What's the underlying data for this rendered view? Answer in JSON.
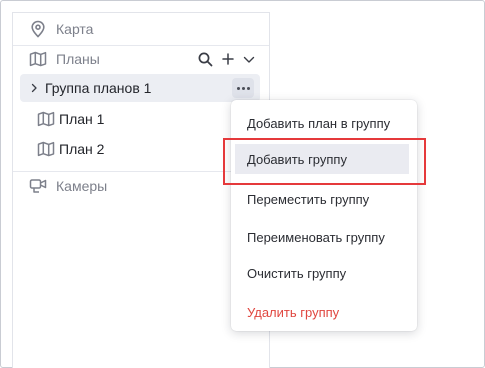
{
  "sidebar": {
    "map_item": {
      "label": "Карта",
      "icon": "location-pin-icon"
    },
    "plans_header": {
      "label": "Планы",
      "icon": "map-icon",
      "actions": [
        "search-icon",
        "plus-icon",
        "chevron-down-icon"
      ]
    },
    "group": {
      "label": "Группа планов 1",
      "more_label": "•••"
    },
    "plans": [
      {
        "label": "План 1",
        "icon": "map-icon"
      },
      {
        "label": "План 2",
        "icon": "map-icon"
      }
    ],
    "cameras_item": {
      "label": "Камеры",
      "icon": "camera-icon"
    }
  },
  "context_menu": {
    "items": [
      {
        "label": "Добавить план в группу"
      },
      {
        "label": "Добавить группу",
        "state": "highlighted"
      },
      {
        "label": "Переместить группу"
      },
      {
        "label": "Переименовать группу"
      },
      {
        "label": "Очистить группу"
      },
      {
        "label": "Удалить группу",
        "style": "danger"
      }
    ]
  },
  "colors": {
    "text_gray": "#7d808b",
    "text_dark": "#23252b",
    "danger": "#e0463f",
    "highlight_border": "#e5393b",
    "selected_bg": "#eceef3"
  }
}
